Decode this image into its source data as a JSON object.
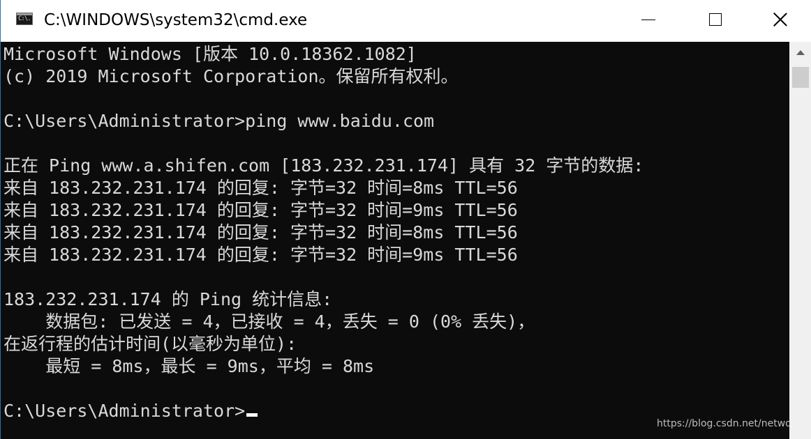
{
  "window": {
    "title": "C:\\WINDOWS\\system32\\cmd.exe",
    "icon_text": "C:\\."
  },
  "console": {
    "lines": [
      "Microsoft Windows [版本 10.0.18362.1082]",
      "(c) 2019 Microsoft Corporation。保留所有权利。",
      "",
      "C:\\Users\\Administrator>ping www.baidu.com",
      "",
      "正在 Ping www.a.shifen.com [183.232.231.174] 具有 32 字节的数据:",
      "来自 183.232.231.174 的回复: 字节=32 时间=8ms TTL=56",
      "来自 183.232.231.174 的回复: 字节=32 时间=9ms TTL=56",
      "来自 183.232.231.174 的回复: 字节=32 时间=8ms TTL=56",
      "来自 183.232.231.174 的回复: 字节=32 时间=9ms TTL=56",
      "",
      "183.232.231.174 的 Ping 统计信息:",
      "    数据包: 已发送 = 4，已接收 = 4，丢失 = 0 (0% 丢失)，",
      "在返行程的估计时间(以毫秒为单位):",
      "    最短 = 8ms，最长 = 9ms，平均 = 8ms",
      "",
      "C:\\Users\\Administrator>"
    ]
  },
  "watermark": "https://blog.csdn.net/networkp",
  "colors": {
    "console_background": "#0c0c0c",
    "console_text": "#d9d9d9",
    "titlebar": "#ffffff"
  },
  "icons": {
    "minimize": "minimize-icon",
    "maximize": "maximize-icon",
    "close": "close-icon",
    "scroll_up": "chevron-up-icon"
  }
}
